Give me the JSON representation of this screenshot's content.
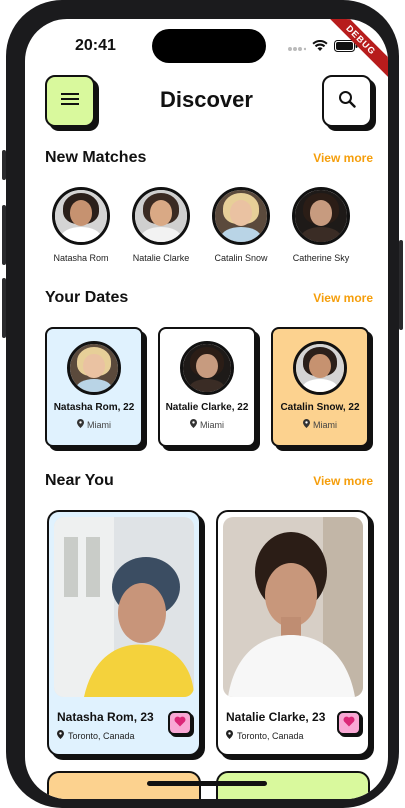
{
  "status_bar": {
    "time": "20:41",
    "debug_label": "DEBUG"
  },
  "header": {
    "title": "Discover",
    "menu_icon": "hamburger-icon",
    "search_icon": "search-icon"
  },
  "colors": {
    "accent_green": "#d9f99d",
    "accent_orange": "#f59e0b",
    "card_blue": "#e0f2fe",
    "card_orange": "#fcd28f",
    "heart_pink": "#f9a8d4"
  },
  "new_matches": {
    "title": "New Matches",
    "view_more": "View more",
    "items": [
      {
        "name": "Natasha Rom"
      },
      {
        "name": "Natalie Clarke"
      },
      {
        "name": "Catalin Snow"
      },
      {
        "name": "Catherine Sky"
      }
    ]
  },
  "your_dates": {
    "title": "Your Dates",
    "view_more": "View more",
    "items": [
      {
        "name": "Natasha Rom, 22",
        "location": "Miami"
      },
      {
        "name": "Natalie Clarke, 22",
        "location": "Miami"
      },
      {
        "name": "Catalin Snow, 22",
        "location": "Miami"
      }
    ]
  },
  "near_you": {
    "title": "Near You",
    "view_more": "View more",
    "items": [
      {
        "name": "Natasha Rom, 23",
        "location": "Toronto, Canada"
      },
      {
        "name": "Natalie Clarke, 23",
        "location": "Toronto, Canada"
      }
    ]
  }
}
